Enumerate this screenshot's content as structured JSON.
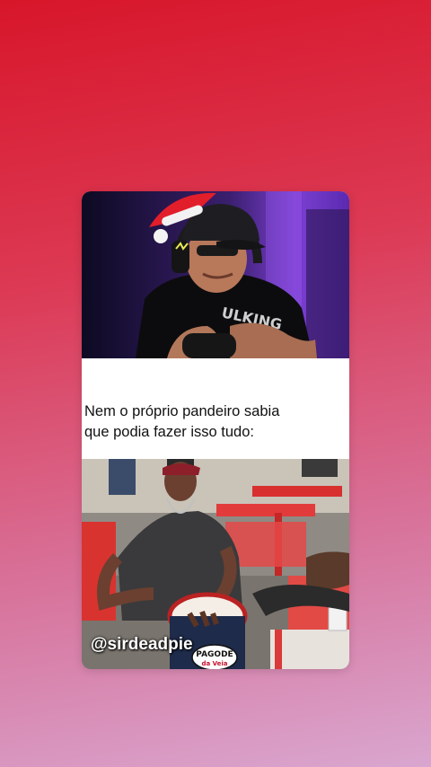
{
  "post": {
    "caption_line1": "Nem o próprio pandeiro sabia",
    "caption_line2": "que podia fazer isso tudo:",
    "watermark": "@sirdeadpie",
    "logo_top": "PAGODE",
    "logo_bottom": "da Veia"
  },
  "colors": {
    "bg_top": "#d8162a",
    "bg_bottom": "#d9a6cf",
    "card": "#ffffff"
  }
}
